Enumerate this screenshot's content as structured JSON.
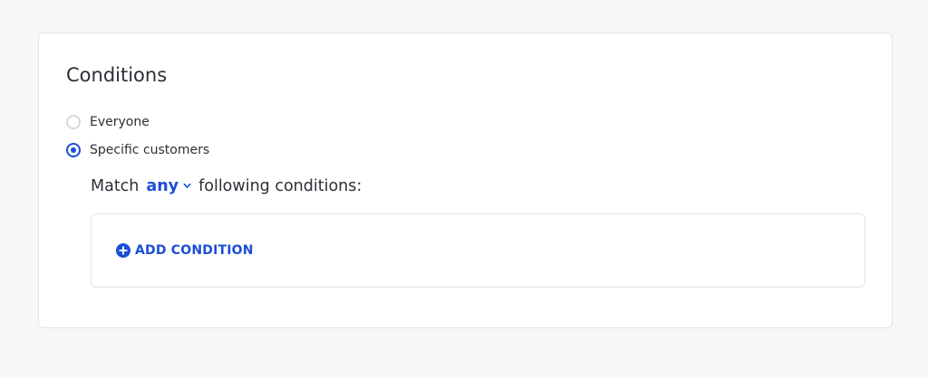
{
  "conditions": {
    "title": "Conditions",
    "options": [
      {
        "label": "Everyone",
        "selected": false
      },
      {
        "label": "Specific customers",
        "selected": true
      }
    ],
    "match": {
      "prefix": "Match",
      "selected_value": "any",
      "suffix": "following conditions:"
    },
    "add_condition_label": "ADD CONDITION"
  },
  "colors": {
    "accent": "#1c4fd6",
    "page_background": "#f6f7f9",
    "border": "#e2e4e8"
  },
  "icons": {
    "match_dropdown": "chevron-down-icon",
    "add_condition": "plus-circle-icon"
  }
}
